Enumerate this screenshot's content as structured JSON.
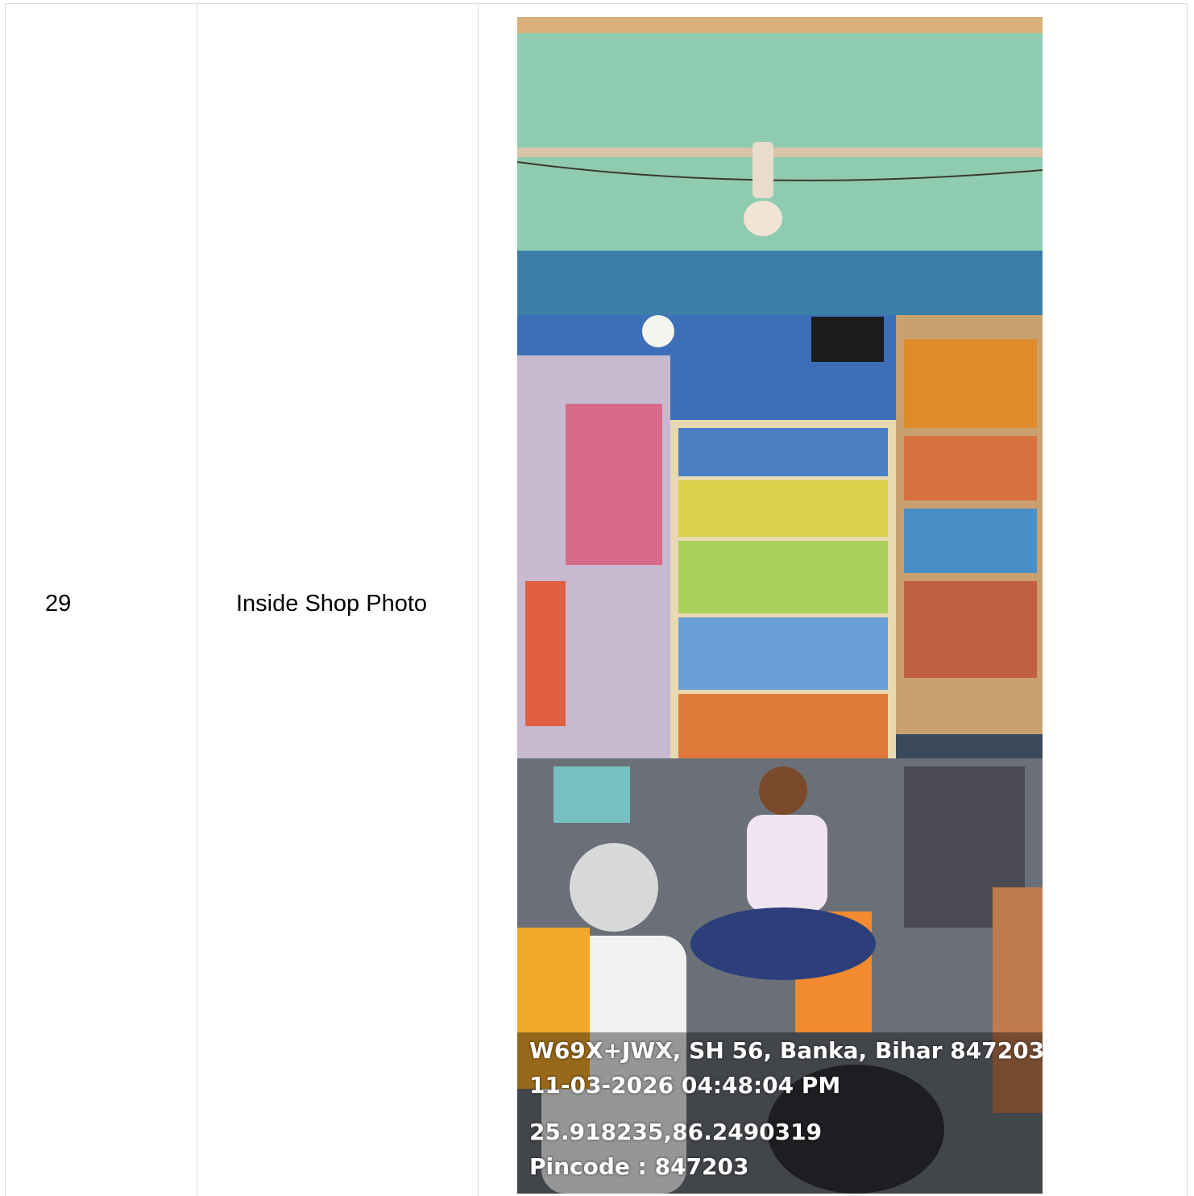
{
  "row": {
    "serial_number": "29",
    "label": "Inside Shop Photo"
  },
  "photo": {
    "description_icon": "shop-interior-photo",
    "geotag": {
      "address": "W69X+JWX, SH 56, Banka, Bihar 847203, ...",
      "datetime": "11-03-2026 04:48:04 PM",
      "coordinates": "25.918235,86.2490319",
      "pincode": "Pincode : 847203"
    }
  },
  "colors": {
    "border": "#dcdcdc",
    "ceiling": "#8fcbb0",
    "beam": "#3b7fa8"
  }
}
